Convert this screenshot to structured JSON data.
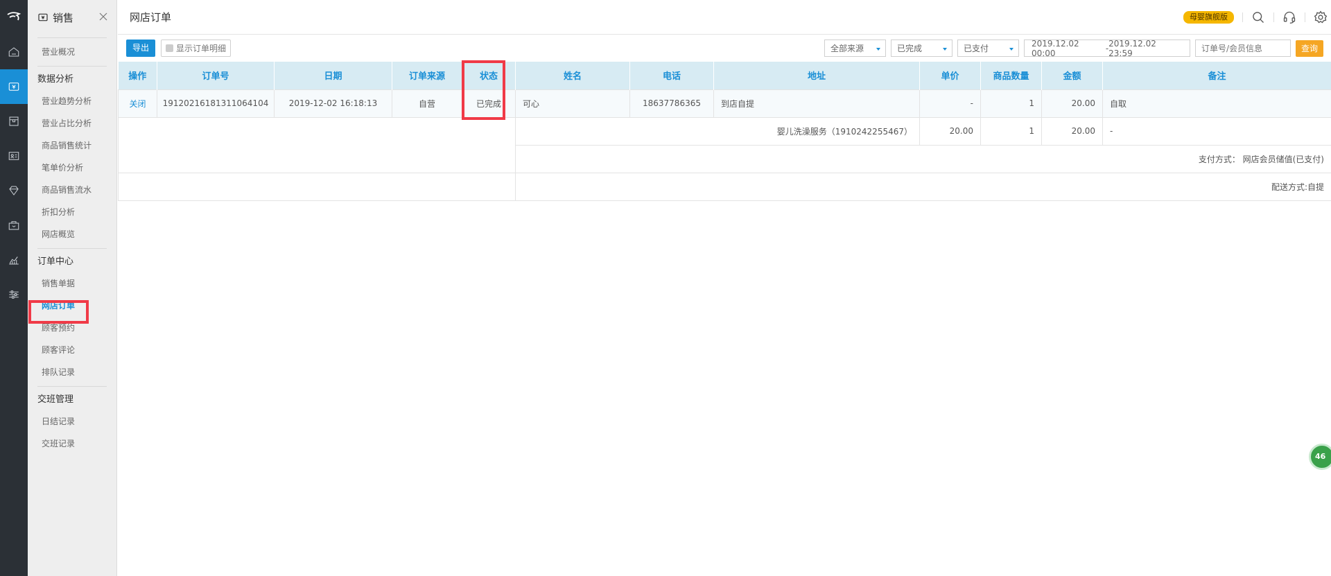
{
  "rail": {
    "icons": [
      "logo-icon",
      "home-icon",
      "sales-icon",
      "goods-icon",
      "member-icon",
      "marketing-icon",
      "staff-icon",
      "report-icon",
      "settings-sliders-icon"
    ]
  },
  "sidebar": {
    "title": "销售",
    "groups": [
      {
        "title": "",
        "items": [
          "营业概况"
        ]
      },
      {
        "title": "数据分析",
        "items": [
          "营业趋势分析",
          "营业占比分析",
          "商品销售统计",
          "笔单价分析",
          "商品销售流水",
          "折扣分析",
          "网店概览"
        ]
      },
      {
        "title": "订单中心",
        "items": [
          "销售单据",
          "网店订单",
          "顾客预约",
          "顾客评论",
          "排队记录"
        ]
      },
      {
        "title": "交班管理",
        "items": [
          "日结记录",
          "交班记录"
        ]
      }
    ],
    "active_item": "网店订单"
  },
  "header": {
    "title": "网店订单",
    "badge": "母婴旗舰版"
  },
  "toolbar": {
    "export_label": "导出",
    "show_detail_label": "显示订单明细",
    "source_select": "全部来源",
    "status_select": "已完成",
    "pay_select": "已支付",
    "date_start": "2019.12.02 00:00",
    "date_sep": "-",
    "date_end": "2019.12.02 23:59",
    "search_placeholder": "订单号/会员信息",
    "query_label": "查询"
  },
  "table": {
    "columns": [
      "操作",
      "订单号",
      "日期",
      "订单来源",
      "状态",
      "姓名",
      "电话",
      "地址",
      "单价",
      "商品数量",
      "金额",
      "备注"
    ],
    "row": {
      "action": "关闭",
      "order_no": "19120216181311064104",
      "date": "2019-12-02 16:18:13",
      "source": "自营",
      "status": "已完成",
      "name": "可心",
      "phone": "18637786365",
      "address": "到店自提",
      "unit_price": "-",
      "qty": "1",
      "amount": "20.00",
      "note": "自取"
    },
    "item_line": {
      "product": "婴儿洗澡服务（1910242255467）",
      "unit_price": "20.00",
      "qty": "1",
      "amount": "20.00",
      "note": "-"
    },
    "payment_line": "支付方式：  网店会员储值(已支付)",
    "delivery_line": "配送方式:自提"
  },
  "float_button": "46"
}
